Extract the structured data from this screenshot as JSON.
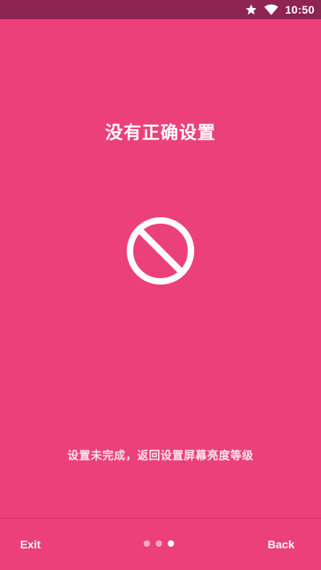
{
  "status_bar": {
    "time": "10:50",
    "icons": [
      "star-icon",
      "wifi-icon"
    ]
  },
  "main": {
    "title": "没有正确设置",
    "icon": "prohibited-icon",
    "message": "设置未完成，返回设置屏幕亮度等级"
  },
  "bottom_bar": {
    "exit_label": "Exit",
    "back_label": "Back",
    "page_count": 3,
    "active_page": 3
  },
  "colors": {
    "background": "#ec407a",
    "status_bar": "#8e2450",
    "dot_inactive": "#f5a6c2",
    "dot_active": "#ffffff"
  }
}
